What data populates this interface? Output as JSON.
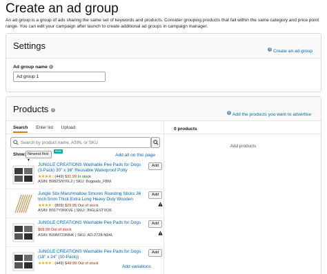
{
  "page": {
    "title": "Create an ad group",
    "intro": "An ad group is a group of ads sharing the same set of keywords and products. Consider grouping products that fall within the same category and price point range. You can edit your campaign after launch to create additional ad groups in campaign manager."
  },
  "settings": {
    "title": "Settings",
    "create_link": "Create an ad group",
    "ad_group_name_label": "Ad group name",
    "ad_group_name_value": "Ad group 1"
  },
  "products": {
    "title": "Products",
    "help_link": "Add the products you want to advertise",
    "tabs": [
      "Search",
      "Enter list",
      "Upload"
    ],
    "active_tab": "Search",
    "search_placeholder": "Search by product name, ASIN, or SKU",
    "show_label": "Show:",
    "sort_value": "Newest first",
    "new_badge": "New",
    "add_all_link": "Add all on this page",
    "add_button_label": "Add",
    "add_variations_link": "Add variations",
    "items": [
      {
        "title": "JUNGLE CREATIONS Washable Pee Pads for Dogs (3-Pack) 30\" x 36\" Reusable Waterproof Potty",
        "rating_count": "(449)",
        "price": "$31.99",
        "stock": "In stock",
        "asin": "ASIN: B08ZSNY6L2",
        "sku": "SKU: 8ogpads_FBM"
      },
      {
        "title": "Jungle Stix Marshmallow Smores Roasting Sticks 36 Inch 5mm Thick Extra Long Heavy Duty Wooden",
        "rating_count": "(809)",
        "price": "$29.95",
        "stock": "Out of stock",
        "asin": "ASIN: B017Y0KKVE",
        "sku": "SKU: JNGLESTIX36"
      },
      {
        "title": "JUNGLE CREATIONS Washable Pee Pads for Dogs",
        "rating_count": "",
        "price": "$69.99",
        "stock": "Out of stock",
        "asin": "ASIN: B09M723MHK",
        "sku": "SKU: AD-2728-N94L"
      },
      {
        "title": "JUNGLE CREATIONS Washable Pee Pads for Dogs (18\" x 24\" (10-Pack))",
        "rating_count": "(449)",
        "price": "$49.99",
        "stock": "Out of stock",
        "asin": "",
        "sku": ""
      }
    ]
  },
  "selected": {
    "count_label": "0 products",
    "empty_text": "Add products"
  },
  "colors": {
    "link": "#0066c0",
    "star": "#e7a300",
    "price": "#b12704",
    "in_stock": "#007600",
    "tab_accent": "#e77600",
    "new_badge": "#00a8a8"
  }
}
